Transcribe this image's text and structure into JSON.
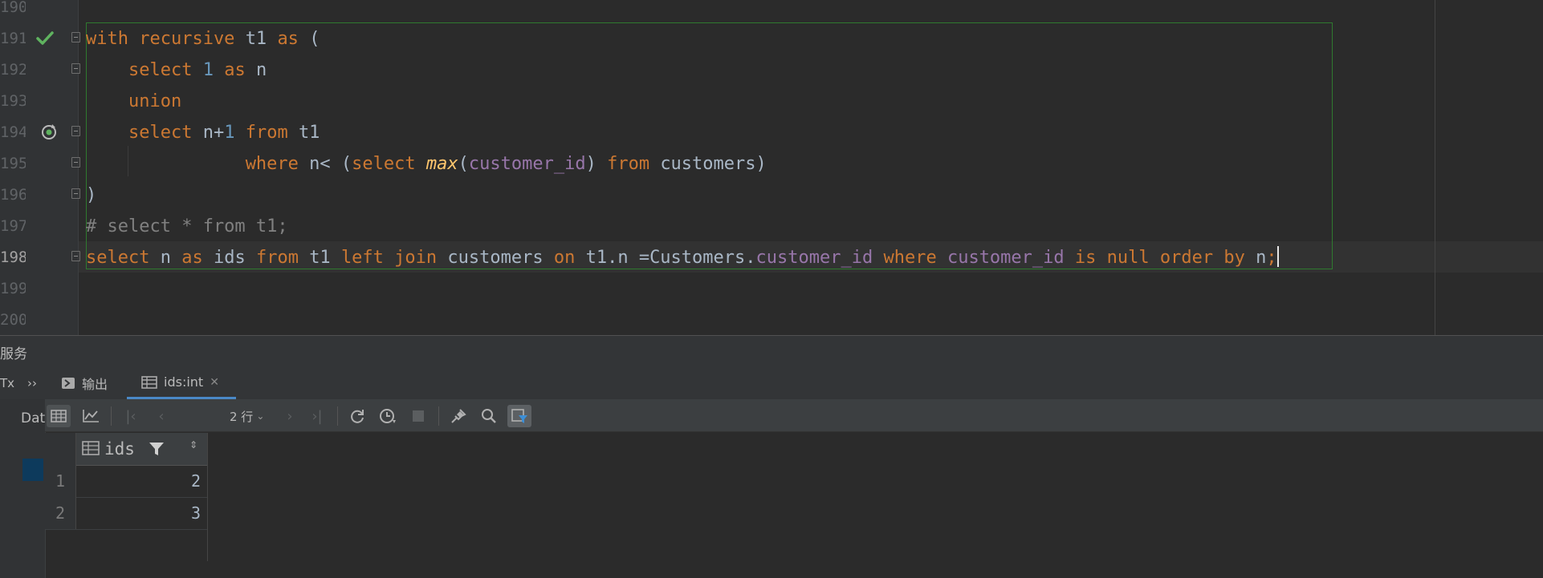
{
  "editor": {
    "line_numbers": [
      "190",
      "191",
      "192",
      "193",
      "194",
      "195",
      "196",
      "197",
      "198",
      "199",
      "200"
    ],
    "code_lines": [
      [
        [
          "k",
          "with recursive "
        ],
        [
          "p",
          "t1 "
        ],
        [
          "k",
          "as "
        ],
        [
          "p",
          "("
        ]
      ],
      [
        [
          "p",
          "    "
        ],
        [
          "k",
          "select "
        ],
        [
          "n",
          "1 "
        ],
        [
          "k",
          "as "
        ],
        [
          "p",
          "n"
        ]
      ],
      [
        [
          "p",
          "    "
        ],
        [
          "k",
          "union"
        ]
      ],
      [
        [
          "p",
          "    "
        ],
        [
          "k",
          "select "
        ],
        [
          "p",
          "n+"
        ],
        [
          "n",
          "1 "
        ],
        [
          "k",
          "from "
        ],
        [
          "p",
          "t1"
        ]
      ],
      [
        [
          "p",
          "               "
        ],
        [
          "k",
          "where "
        ],
        [
          "p",
          "n< ("
        ],
        [
          "k",
          "select "
        ],
        [
          "f",
          "max"
        ],
        [
          "p",
          "("
        ],
        [
          "c",
          "customer_id"
        ],
        [
          "p",
          ") "
        ],
        [
          "k",
          "from "
        ],
        [
          "p",
          "customers)"
        ]
      ],
      [
        [
          "p",
          ")"
        ]
      ],
      [
        [
          "cm",
          "# select * from t1;"
        ]
      ],
      [
        [
          "k",
          "select "
        ],
        [
          "p",
          "n "
        ],
        [
          "k",
          "as "
        ],
        [
          "p",
          "ids "
        ],
        [
          "k",
          "from "
        ],
        [
          "p",
          "t1 "
        ],
        [
          "k",
          "left join "
        ],
        [
          "p",
          "customers "
        ],
        [
          "k",
          "on "
        ],
        [
          "p",
          "t1.n =Customers."
        ],
        [
          "c",
          "customer_id "
        ],
        [
          "k",
          "where "
        ],
        [
          "c",
          "customer_id "
        ],
        [
          "k",
          "is null order by "
        ],
        [
          "p",
          "n"
        ],
        [
          "k",
          ";"
        ]
      ]
    ],
    "gutter_icons": {
      "line_191": "check-icon",
      "line_194": "recursive-query-icon"
    }
  },
  "services": {
    "title": "服务",
    "tabs": [
      {
        "label": "输出",
        "icon": "console-icon"
      },
      {
        "label": "ids:int",
        "icon": "table-icon",
        "close": "✕"
      }
    ],
    "left_strip_text": [
      "Tx",
      "Dat"
    ],
    "toolbar": {
      "rows_label": "2 行",
      "icons": [
        "grid-view-icon",
        "chart-icon",
        "first-page-icon",
        "prev-page-icon",
        "rows-select",
        "next-page-icon",
        "last-page-icon",
        "refresh-icon",
        "history-icon",
        "stop-icon",
        "pin-icon",
        "search-icon",
        "filter-icon"
      ]
    }
  },
  "result_grid": {
    "column": "ids",
    "rows": [
      {
        "num": "1",
        "value": "2"
      },
      {
        "num": "2",
        "value": "3"
      }
    ]
  },
  "colors": {
    "keyword": "#cc7832",
    "number": "#6897bb",
    "field": "#9876aa",
    "function": "#ffc66d",
    "comment": "#808080",
    "selection_border": "#2f7a2f"
  }
}
